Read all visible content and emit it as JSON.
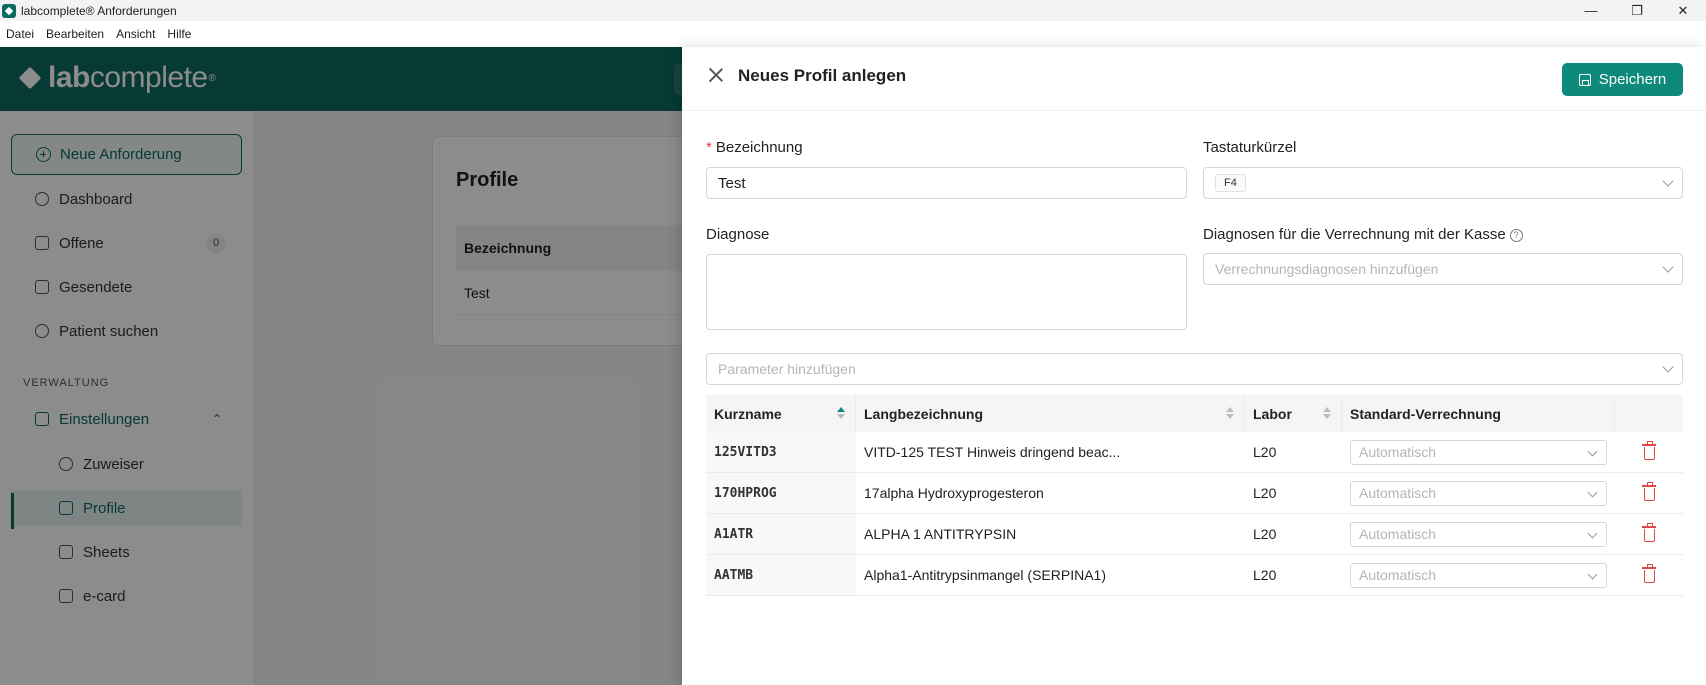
{
  "window": {
    "title": "labcomplete® Anforderungen",
    "minimize": "—",
    "maximize": "❐",
    "close": "✕"
  },
  "menu": [
    "Datei",
    "Bearbeiten",
    "Ansicht",
    "Hilfe"
  ],
  "logo": {
    "bold": "lab",
    "rest": "complete",
    "mark": "®"
  },
  "sidebar": {
    "new_request": "Neue Anforderung",
    "items": [
      {
        "label": "Dashboard",
        "icon": "gauge-icon"
      },
      {
        "label": "Offene",
        "icon": "clipboard-icon",
        "badge": "0"
      },
      {
        "label": "Gesendete",
        "icon": "send-icon"
      },
      {
        "label": "Patient suchen",
        "icon": "search-icon"
      }
    ],
    "section": "VERWALTUNG",
    "settings": "Einstellungen",
    "subitems": [
      {
        "label": "Zuweiser",
        "icon": "users-icon"
      },
      {
        "label": "Profile",
        "icon": "list-icon"
      },
      {
        "label": "Sheets",
        "icon": "sheet-icon"
      },
      {
        "label": "e-card",
        "icon": "card-icon"
      }
    ]
  },
  "content": {
    "title": "Profile",
    "column": "Bezeichnung",
    "row": "Test"
  },
  "drawer": {
    "title": "Neues Profil anlegen",
    "save": "Speichern",
    "bezeichnung_label": "Bezeichnung",
    "bezeichnung_value": "Test",
    "shortcut_label": "Tastaturkürzel",
    "shortcut_value": "F4",
    "diagnose_label": "Diagnose",
    "kasse_label": "Diagnosen für die Verrechnung mit der Kasse",
    "kasse_placeholder": "Verrechnungsdiagnosen hinzufügen",
    "param_placeholder": "Parameter hinzufügen",
    "table": {
      "headers": [
        "Kurzname",
        "Langbezeichnung",
        "Labor",
        "Standard-Verrechnung"
      ],
      "rows": [
        {
          "kurz": "125VITD3",
          "lang": "VITD-125 TEST Hinweis dringend beac...",
          "labor": "L20",
          "verr": "Automatisch"
        },
        {
          "kurz": "170HPROG",
          "lang": "17alpha Hydroxyprogesteron",
          "labor": "L20",
          "verr": "Automatisch"
        },
        {
          "kurz": "A1ATR",
          "lang": "ALPHA 1 ANTITRYPSIN",
          "labor": "L20",
          "verr": "Automatisch"
        },
        {
          "kurz": "AATMB",
          "lang": "Alpha1-Antitrypsinmangel (SERPINA1)",
          "labor": "L20",
          "verr": "Automatisch"
        }
      ]
    }
  },
  "colors": {
    "brand": "#0d6b61",
    "primary_button": "#0d8a7a",
    "danger": "#e04848"
  }
}
